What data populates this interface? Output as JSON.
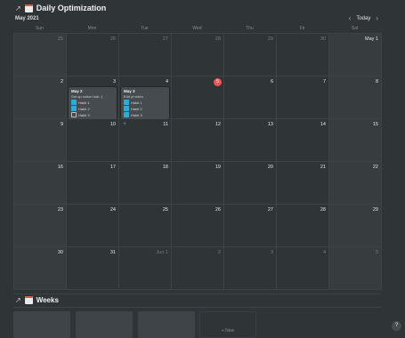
{
  "header": {
    "title": "Daily Optimization",
    "arrow": "↗"
  },
  "calendar": {
    "month_label": "May 2021",
    "today_label": "Today",
    "prev": "‹",
    "next": "›",
    "weekdays": [
      "Sun",
      "Mon",
      "Tue",
      "Wed",
      "Thu",
      "Fri",
      "Sat"
    ],
    "weeks": [
      [
        {
          "d": "25",
          "dim": true
        },
        {
          "d": "26",
          "dim": true
        },
        {
          "d": "27",
          "dim": true
        },
        {
          "d": "28",
          "dim": true
        },
        {
          "d": "29",
          "dim": true
        },
        {
          "d": "30",
          "dim": true
        },
        {
          "d": "May 1"
        }
      ],
      [
        {
          "d": "2"
        },
        {
          "d": "3"
        },
        {
          "d": "4"
        },
        {
          "d": "5",
          "today": true
        },
        {
          "d": "6"
        },
        {
          "d": "7"
        },
        {
          "d": "8"
        }
      ],
      [
        {
          "d": "9"
        },
        {
          "d": "10"
        },
        {
          "d": "11"
        },
        {
          "d": "12"
        },
        {
          "d": "13"
        },
        {
          "d": "14"
        },
        {
          "d": "15"
        }
      ],
      [
        {
          "d": "16"
        },
        {
          "d": "17"
        },
        {
          "d": "18"
        },
        {
          "d": "19"
        },
        {
          "d": "20"
        },
        {
          "d": "21"
        },
        {
          "d": "22"
        }
      ],
      [
        {
          "d": "23"
        },
        {
          "d": "24"
        },
        {
          "d": "25"
        },
        {
          "d": "26"
        },
        {
          "d": "27"
        },
        {
          "d": "28"
        },
        {
          "d": "29"
        }
      ],
      [
        {
          "d": "30"
        },
        {
          "d": "31"
        },
        {
          "d": "Jun 1",
          "dim": true
        },
        {
          "d": "2",
          "dim": true
        },
        {
          "d": "3",
          "dim": true
        },
        {
          "d": "4",
          "dim": true
        },
        {
          "d": "5",
          "dim": true
        }
      ]
    ],
    "plus": "+",
    "cards": [
      {
        "title": "May 2",
        "subtitle": "Set up notion hub :)",
        "habits": [
          {
            "label": "Habit 1",
            "checked": true
          },
          {
            "label": "Habit 2",
            "checked": true
          },
          {
            "label": "Habit 3",
            "checked": false
          }
        ]
      },
      {
        "title": "May 3",
        "subtitle": "Edit yt video",
        "habits": [
          {
            "label": "Habit 1",
            "checked": true
          },
          {
            "label": "Habit 2",
            "checked": true
          },
          {
            "label": "Habit 3",
            "checked": true
          }
        ]
      }
    ]
  },
  "weeks_section": {
    "title": "Weeks",
    "arrow": "↗",
    "new_label": "+ New"
  },
  "help": {
    "label": "?"
  },
  "colors": {
    "background": "#2f3437",
    "today": "#eb5757",
    "checkbox": "#2eaadc"
  }
}
